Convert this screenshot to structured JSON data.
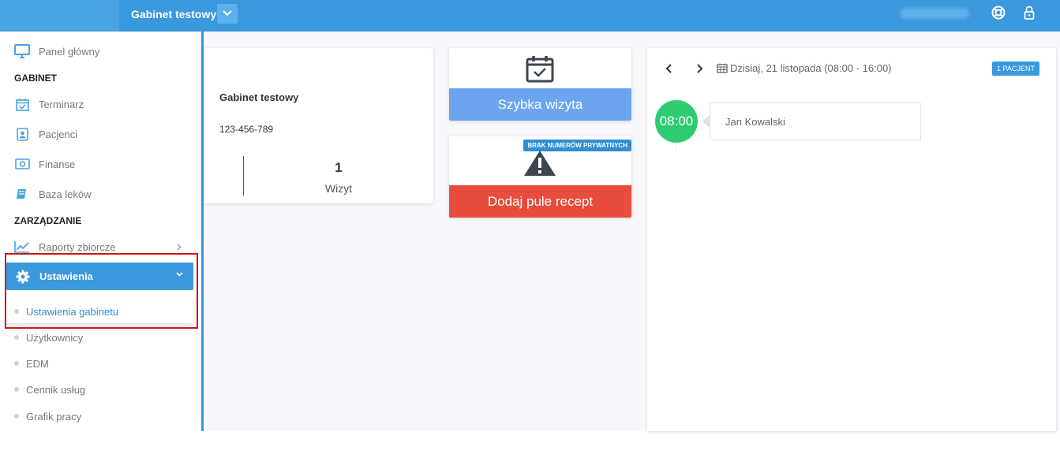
{
  "topbar": {
    "clinic_name": "Gabinet testowy",
    "icons": [
      "chevron-down-icon",
      "lifebuoy-icon",
      "lock-icon"
    ]
  },
  "sidebar": {
    "main_item": "Panel główny",
    "section_gabinet": "GABINET",
    "gabinet_items": [
      "Terminarz",
      "Pacjenci",
      "Finanse",
      "Baza leków"
    ],
    "section_zarzadzanie": "ZARZĄDZANIE",
    "reports": "Raporty zbiorcze",
    "settings": "Ustawienia",
    "settings_sub": [
      "Ustawienia gabinetu",
      "Użytkownicy",
      "EDM",
      "Cennik usług",
      "Grafik pracy"
    ]
  },
  "info_card": {
    "name": "Gabinet testowy",
    "phone": "123-456-789",
    "visits_count": "1",
    "visits_label": "Wizyt"
  },
  "quick_visit": {
    "label": "Szybka wizyta"
  },
  "recipe": {
    "badge": "BRAK NUMERÓW PRYWATNYCH",
    "label": "Dodaj pule recept"
  },
  "schedule": {
    "date_text": "Dzisiaj, 21 listopada (08:00 - 16:00)",
    "patient_badge": "1 PACJENT",
    "appointment": {
      "time": "08:00",
      "patient": "Jan Kowalski"
    }
  },
  "colors": {
    "primary": "#3a98dc",
    "danger": "#e74c3c",
    "success": "#2ecc71",
    "quick": "#6ba5f0",
    "highlight": "#d0141a"
  }
}
